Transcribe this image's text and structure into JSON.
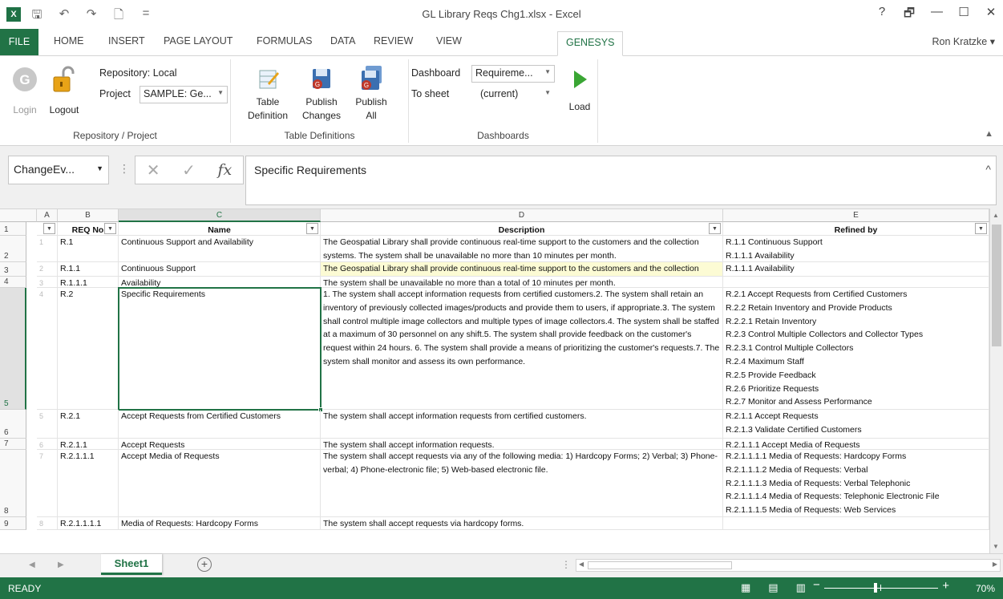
{
  "window": {
    "title": "GL Library Reqs Chg1.xlsx - Excel",
    "user": "Ron Kratzke",
    "help": "?",
    "restore": "🗗",
    "minimize": "—",
    "maximize": "☐",
    "close": "✕",
    "app_icon": "X"
  },
  "qat": {
    "save": "🖫",
    "undo": "↶",
    "redo": "↷",
    "new": "🗋",
    "customize": "="
  },
  "tabs": [
    "FILE",
    "HOME",
    "INSERT",
    "PAGE LAYOUT",
    "FORMULAS",
    "DATA",
    "REVIEW",
    "VIEW",
    "GENESYS"
  ],
  "ribbon": {
    "repo_group": {
      "label": "Repository / Project",
      "login": "Login",
      "logout": "Logout",
      "repository_label": "Repository: Local",
      "project_label": "Project",
      "project_value": "SAMPLE: Ge..."
    },
    "table_group": {
      "label": "Table Definitions",
      "table_def_1": "Table",
      "table_def_2": "Definition",
      "publish_changes_1": "Publish",
      "publish_changes_2": "Changes",
      "publish_all_1": "Publish",
      "publish_all_2": "All"
    },
    "dash_group": {
      "label": "Dashboards",
      "dashboard_label": "Dashboard",
      "dashboard_value": "Requireme...",
      "sheet_label": "To sheet",
      "sheet_value": "(current)",
      "load": "Load"
    }
  },
  "formula_bar": {
    "name_box": "ChangeEv...",
    "content": "Specific Requirements"
  },
  "columns": [
    "A",
    "B",
    "C",
    "D",
    "E"
  ],
  "header_row": {
    "num": "1",
    "b": "REQ No",
    "c": "Name",
    "d": "Description",
    "e": "Refined by"
  },
  "rows": [
    {
      "num": "2",
      "a": "1",
      "b": "R.1",
      "c": "Continuous Support and Availability",
      "d": "The Geospatial Library shall provide continuous real-time support to the customers and the collection systems. The system shall be unavailable no more than 10 minutes per month.",
      "e": "R.1.1 Continuous Support\nR.1.1.1 Availability"
    },
    {
      "num": "3",
      "a": "2",
      "b": "R.1.1",
      "c": "Continuous Support",
      "d": "The Geospatial Library shall provide continuous real-time support to the customers and the collection systems.  CHANGE THIS",
      "e": "R.1.1.1 Availability"
    },
    {
      "num": "4",
      "a": "3",
      "b": "R.1.1.1",
      "c": "Availability",
      "d": "The system shall be unavailable no more than a total of 10 minutes per month.",
      "e": ""
    },
    {
      "num": "5",
      "a": "4",
      "b": "R.2",
      "c": "Specific Requirements",
      "d": "1. The system shall accept information requests from certified customers.2. The system shall retain an inventory of previously collected images/products and provide them to users, if appropriate.3. The system shall control multiple image collectors and multiple types of image collectors.4. The system shall be staffed at a maximum of 30 personnel on any shift.5. The system shall provide feedback on the customer's request within 24 hours. 6. The system shall provide a means of prioritizing the customer's requests.7. The system shall monitor and assess its own performance.",
      "e": "R.2.1 Accept Requests from Certified Customers\nR.2.2 Retain Inventory and Provide Products\nR.2.2.1 Retain Inventory\nR.2.3 Control Multiple Collectors and Collector Types\nR.2.3.1 Control Multiple Collectors\nR.2.4 Maximum Staff\nR.2.5 Provide Feedback\nR.2.6 Prioritize Requests\nR.2.7 Monitor and Assess Performance"
    },
    {
      "num": "6",
      "a": "5",
      "b": "R.2.1",
      "c": "Accept Requests from Certified Customers",
      "d": "The system shall accept information requests from certified customers.",
      "e": "R.2.1.1 Accept Requests\nR.2.1.3 Validate Certified Customers"
    },
    {
      "num": "7",
      "a": "6",
      "b": "R.2.1.1",
      "c": "Accept Requests",
      "d": "The system shall accept information requests.",
      "e": "R.2.1.1.1 Accept Media of Requests"
    },
    {
      "num": "8",
      "a": "7",
      "b": "R.2.1.1.1",
      "c": "Accept Media of Requests",
      "d": "The system shall accept requests via any of the following media: 1) Hardcopy Forms; 2) Verbal; 3) Phone-verbal; 4) Phone-electronic file; 5) Web-based electronic file.",
      "e": "R.2.1.1.1.1 Media of Requests: Hardcopy Forms\nR.2.1.1.1.2 Media of Requests: Verbal\nR.2.1.1.1.3 Media of Requests: Verbal Telephonic\nR.2.1.1.1.4 Media of Requests: Telephonic Electronic File\nR.2.1.1.1.5 Media of Requests: Web Services"
    },
    {
      "num": "9",
      "a": "8",
      "b": "R.2.1.1.1.1",
      "c": "Media of Requests: Hardcopy Forms",
      "d": "The system shall accept requests via hardcopy forms.",
      "e": ""
    }
  ],
  "sheet_tab": "Sheet1",
  "add_sheet": "+",
  "status": {
    "ready": "READY",
    "zoom": "70%"
  }
}
